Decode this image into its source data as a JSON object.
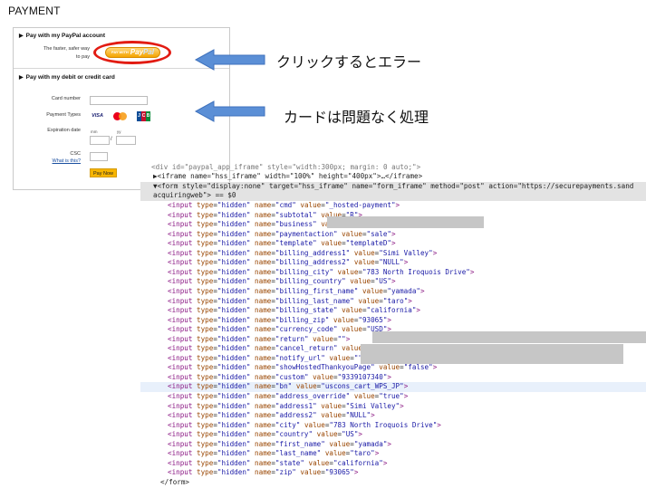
{
  "page_title": "PAYMENT",
  "paypal_section": {
    "heading": "Pay with my PayPal account",
    "tagline_line1": "The faster, safer way",
    "tagline_line2": "to pay",
    "button_prefix": "PAY WITH",
    "button_brand_1": "Pay",
    "button_brand_2": "Pal",
    "highlight_color": "#e21b12"
  },
  "card_section": {
    "heading": "Pay with my debit or credit card",
    "card_number_label": "Card number",
    "payment_types_label": "Payment Types",
    "expiration_label": "Expiration date",
    "mm_label": "mm",
    "yy_label": "yy",
    "slash": "/",
    "csc_label": "CSC",
    "whats_this": "What is this?",
    "card_brands": [
      "VISA",
      "MasterCard",
      "JCB"
    ],
    "visa_text": "VISA",
    "jcb_letters": [
      "J",
      "C",
      "B"
    ],
    "pay_now": "Pay Now"
  },
  "annotations": {
    "note_1": "クリックするとエラー",
    "note_2": "カードは問題なく処理",
    "arrow_color": "#5b8fd6"
  },
  "code_panel": {
    "top_line": "<div id=\"paypal_app_iframe\" style=\"width:300px; margin: 0 auto;\">",
    "iframe_line": "▶<iframe name=\"hss_iframe\" width=\"100%\" height=\"400px\">…</iframe>",
    "form_line_1": "▼<form style=\"display:none\" target=\"hss_iframe\" name=\"form_iframe\" method=\"post\" action=\"https://securepayments.sand",
    "form_line_2": "acquiringweb\"> == $0",
    "close_line": "</form>",
    "inputs": [
      {
        "name": "cmd",
        "value": "_hosted-payment"
      },
      {
        "name": "subtotal",
        "value": "R"
      },
      {
        "name": "business",
        "value": ""
      },
      {
        "name": "paymentaction",
        "value": "sale"
      },
      {
        "name": "template",
        "value": "templateD"
      },
      {
        "name": "billing_address1",
        "value": "Simi Valley"
      },
      {
        "name": "billing_address2",
        "value": "NULL"
      },
      {
        "name": "billing_city",
        "value": "783 North Iroquois Drive"
      },
      {
        "name": "billing_country",
        "value": "US"
      },
      {
        "name": "billing_first_name",
        "value": "yamada"
      },
      {
        "name": "billing_last_name",
        "value": "taro"
      },
      {
        "name": "billing_state",
        "value": "california"
      },
      {
        "name": "billing_zip",
        "value": "93065"
      },
      {
        "name": "currency_code",
        "value": "USD"
      },
      {
        "name": "return",
        "value": ""
      },
      {
        "name": "cancel_return",
        "value": ""
      },
      {
        "name": "notify_url",
        "value": ""
      },
      {
        "name": "showHostedThankyouPage",
        "value": "false"
      },
      {
        "name": "custom",
        "value": "9339107340"
      },
      {
        "name": "bn",
        "value": "uscons_cart_WPS_JP"
      },
      {
        "name": "address_override",
        "value": "true"
      },
      {
        "name": "address1",
        "value": "Simi Valley"
      },
      {
        "name": "address2",
        "value": "NULL"
      },
      {
        "name": "city",
        "value": "783 North Iroquois Drive"
      },
      {
        "name": "country",
        "value": "US"
      },
      {
        "name": "first_name",
        "value": "yamada"
      },
      {
        "name": "last_name",
        "value": "taro"
      },
      {
        "name": "state",
        "value": "california"
      },
      {
        "name": "zip",
        "value": "93065"
      }
    ]
  }
}
